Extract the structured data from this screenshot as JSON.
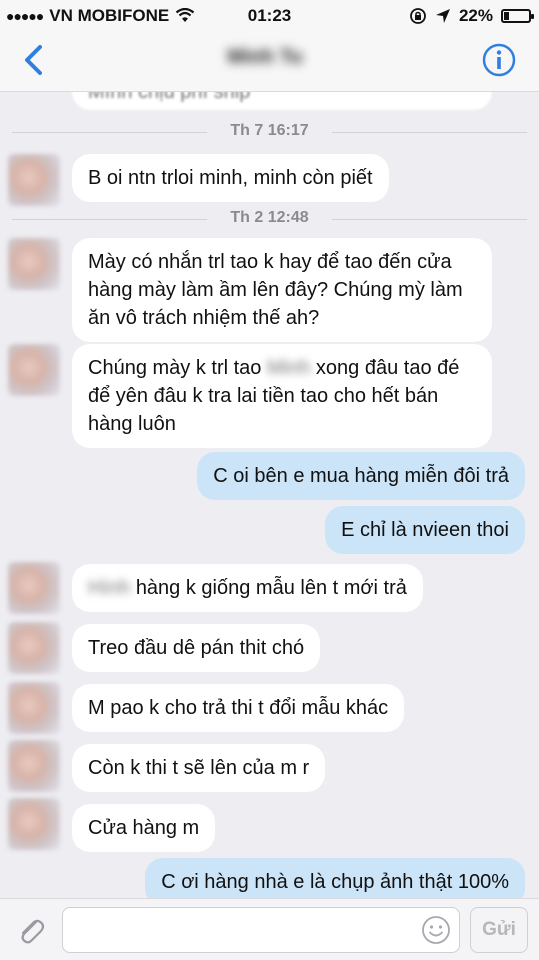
{
  "status": {
    "carrier": "VN MOBIFONE",
    "time": "01:23",
    "battery": "22%",
    "battery_level": 0.22
  },
  "header": {
    "contact_name": "Minh Tu"
  },
  "chat": {
    "partial_message": "Mình chịu phí ship",
    "timestamps": [
      "Th 7 16:17",
      "Th 2 12:48"
    ],
    "messages": [
      {
        "dir": "in",
        "text": "B oi ntn trloi minh,  minh còn piết"
      },
      {
        "dir": "in",
        "text": "Mày có nhắn trl tao k hay để tao đến cửa hàng mày làm ầm lên đây? Chúng mỳ làm ăn vô trách nhiệm thế ah?"
      },
      {
        "dir": "in",
        "text_a": "Chúng mày k trl tao",
        "blurred": "Minh",
        "text_b": "xong đâu tao đé để yên đâu k tra lai tiền tao cho hết bán hàng luôn"
      },
      {
        "dir": "out",
        "text": "C oi bên e mua hàng miễn đôi trả"
      },
      {
        "dir": "out",
        "text": "E chỉ là nvieen thoi"
      },
      {
        "dir": "in",
        "blurred": "Hình",
        "text": "hàng k giống mẫu lên t mới trả"
      },
      {
        "dir": "in",
        "text": "Treo đầu dê pán thit chó"
      },
      {
        "dir": "in",
        "text": "M pao k cho trả thi t đổi mẫu khác"
      },
      {
        "dir": "in",
        "text": "Còn k thi t sẽ lên của m r"
      },
      {
        "dir": "in",
        "text": "Cửa hàng m"
      },
      {
        "dir": "out",
        "text": "C ơi hàng nhà e là chụp ảnh thật 100%"
      }
    ]
  },
  "composer": {
    "placeholder": "",
    "send_label": "Gửi"
  },
  "colors": {
    "accent": "#2f7fe0",
    "incoming_bubble": "#ffffff",
    "outgoing_bubble": "#cbe4f8",
    "background": "#ededf2"
  },
  "icons": [
    "back-chevron-icon",
    "info-icon",
    "wifi-icon",
    "lock-rotation-icon",
    "location-arrow-icon",
    "battery-icon",
    "paperclip-icon",
    "smiley-icon"
  ]
}
